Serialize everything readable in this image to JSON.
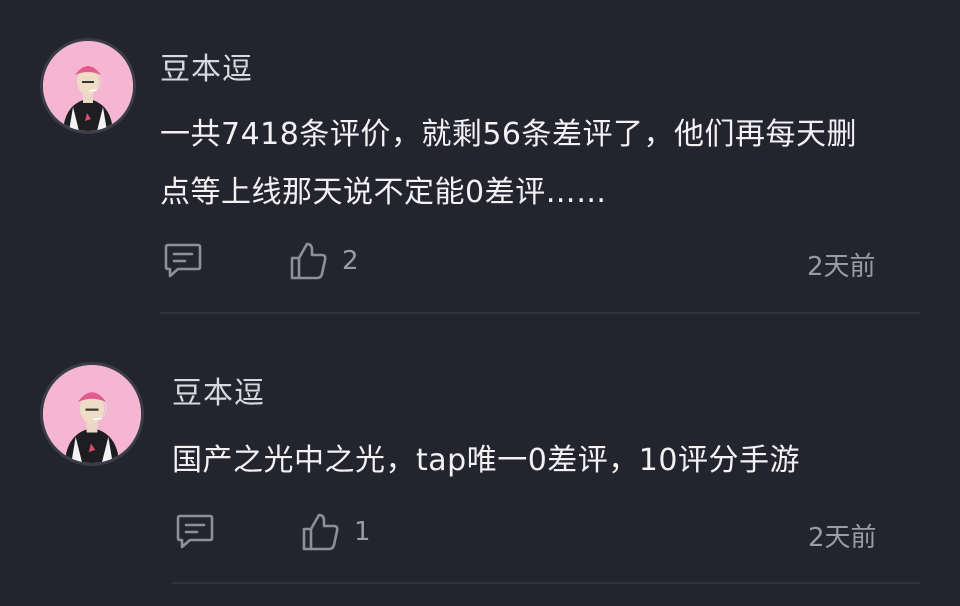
{
  "comments": [
    {
      "username": "豆本逗",
      "content_line1": "一共7418条评价，就剩56条差评了，他们再每天删",
      "content_line2": "点等上线那天说不定能0差评……",
      "likes": "2",
      "time": "2天前"
    },
    {
      "username": "豆本逗",
      "content_line1": "国产之光中之光，tap唯一0差评，10评分手游",
      "likes": "1",
      "time": "2天前"
    }
  ],
  "icons": {
    "reply": "comment-bubble-icon",
    "like": "thumbs-up-icon"
  },
  "colors": {
    "background": "#23242e",
    "avatar_bg": "#f4b6d0",
    "text": "#f2f2f5",
    "muted": "#9a9ba6",
    "divider": "#32343f"
  }
}
